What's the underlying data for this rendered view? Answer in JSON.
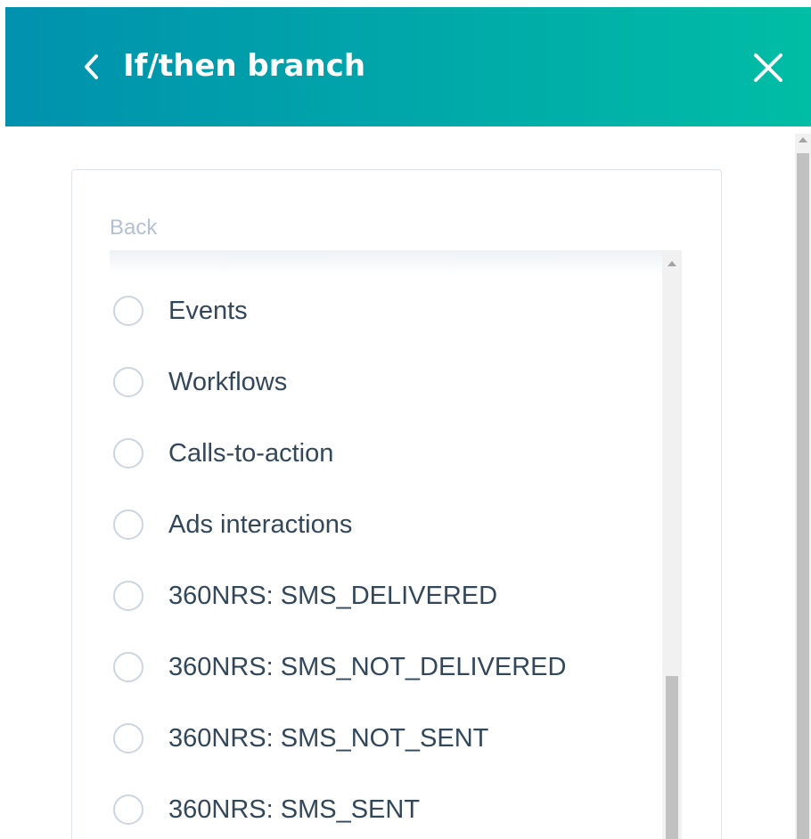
{
  "header": {
    "title": "If/then branch",
    "back_icon": "chevron-left-icon",
    "close_icon": "close-icon",
    "colors": {
      "gradient_start": "#0091ae",
      "gradient_end": "#00bda5"
    }
  },
  "panel": {
    "back_label": "Back",
    "options": [
      {
        "label": "Events"
      },
      {
        "label": "Workflows"
      },
      {
        "label": "Calls-to-action"
      },
      {
        "label": "Ads interactions"
      },
      {
        "label": "360NRS: SMS_DELIVERED"
      },
      {
        "label": "360NRS: SMS_NOT_DELIVERED"
      },
      {
        "label": "360NRS: SMS_NOT_SENT"
      },
      {
        "label": "360NRS: SMS_SENT"
      }
    ]
  }
}
